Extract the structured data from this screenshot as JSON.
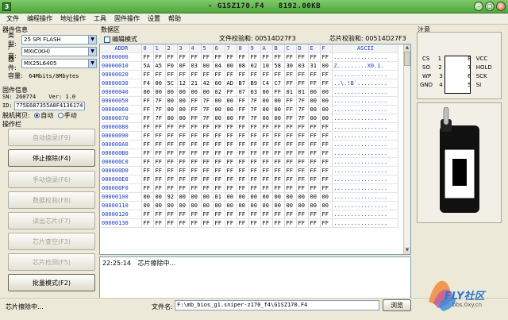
{
  "window": {
    "title": "- G1SZ170.F4   8192.00KB",
    "icon_label": "3"
  },
  "menu": [
    "文件",
    "编程操作",
    "地址操作",
    "工具",
    "固件操作",
    "设置",
    "帮助"
  ],
  "device_info": {
    "group_label": "器件信息",
    "type_label": "类型:",
    "type_value": "25 SPI FLASH",
    "vendor_label": "厂商:",
    "vendor_value": "MXIC(KH)",
    "device_label": "器件:",
    "device_value": "MX25L6405",
    "capacity_label": "容量:",
    "capacity_value": "64Mbits/8Mbytes"
  },
  "firmware_info": {
    "group_label": "固件信息",
    "sn_label": "SN:",
    "sn_value": "260774",
    "ver_label": "Ver:",
    "ver_value": "1.0",
    "id_label": "ID:",
    "id_value": "775E687355A0F4136174",
    "offline_label": "脱机拷贝:",
    "auto_label": "自动",
    "manual_label": "手动",
    "auto_selected": true
  },
  "operations": {
    "group_label": "操作栏",
    "buttons": [
      {
        "label": "自动烧录(F9)",
        "enabled": false
      },
      {
        "label": "停止擦除(F4)",
        "enabled": true
      },
      {
        "label": "手动烧录(F6)",
        "enabled": false
      },
      {
        "label": "数据校验(F8)",
        "enabled": false
      },
      {
        "label": "读出芯片(F7)",
        "enabled": false
      },
      {
        "label": "芯片查空(F3)",
        "enabled": false
      },
      {
        "label": "芯片检测(F5)",
        "enabled": false
      },
      {
        "label": "批量模式(F2)",
        "enabled": true
      }
    ]
  },
  "data_area": {
    "group_label": "数据区",
    "edit_mode_label": "编辑模式",
    "file_checksum_label": "文件校验和:",
    "file_checksum": "00514D27F3",
    "chip_checksum_label": "芯片校验和:",
    "chip_checksum": "00514D27F3",
    "header": [
      "ADDR",
      "0",
      "1",
      "2",
      "3",
      "4",
      "5",
      "6",
      "7",
      "8",
      "9",
      "A",
      "B",
      "C",
      "D",
      "E",
      "F",
      "ASCII"
    ],
    "rows": [
      [
        "00000000",
        "FF",
        "FF",
        "FF",
        "FF",
        "FF",
        "FF",
        "FF",
        "FF",
        "FF",
        "FF",
        "FF",
        "FF",
        "FF",
        "FF",
        "FF",
        "FF",
        "................"
      ],
      [
        "00000010",
        "5A",
        "A5",
        "F0",
        "0F",
        "03",
        "00",
        "04",
        "00",
        "08",
        "02",
        "10",
        "58",
        "30",
        "03",
        "31",
        "00",
        "Z.........X0.1."
      ],
      [
        "00000020",
        "FF",
        "FF",
        "FF",
        "FF",
        "FF",
        "FF",
        "FF",
        "FF",
        "FF",
        "FF",
        "FF",
        "FF",
        "FF",
        "FF",
        "FF",
        "FF",
        "................"
      ],
      [
        "00000030",
        "F4",
        "00",
        "5C",
        "12",
        "21",
        "42",
        "60",
        "AD",
        "B7",
        "B9",
        "C4",
        "C7",
        "FF",
        "FF",
        "FF",
        "FF",
        "..\\.!B`........."
      ],
      [
        "00000040",
        "00",
        "00",
        "00",
        "00",
        "00",
        "00",
        "02",
        "FF",
        "07",
        "03",
        "00",
        "FF",
        "01",
        "01",
        "00",
        "00",
        "................"
      ],
      [
        "00000050",
        "FF",
        "7F",
        "00",
        "00",
        "FF",
        "7F",
        "00",
        "00",
        "FF",
        "7F",
        "00",
        "00",
        "FF",
        "7F",
        "00",
        "00",
        "................"
      ],
      [
        "00000060",
        "FF",
        "7F",
        "00",
        "00",
        "FF",
        "7F",
        "00",
        "00",
        "FF",
        "7F",
        "00",
        "00",
        "FF",
        "7F",
        "00",
        "00",
        "................"
      ],
      [
        "00000070",
        "FF",
        "7F",
        "00",
        "00",
        "FF",
        "7F",
        "00",
        "00",
        "FF",
        "7F",
        "00",
        "00",
        "FF",
        "7F",
        "00",
        "00",
        "................"
      ],
      [
        "00000080",
        "FF",
        "FF",
        "FF",
        "FF",
        "FF",
        "FF",
        "FF",
        "FF",
        "FF",
        "FF",
        "FF",
        "FF",
        "FF",
        "FF",
        "FF",
        "FF",
        "................"
      ],
      [
        "00000090",
        "FF",
        "FF",
        "FF",
        "FF",
        "FF",
        "FF",
        "FF",
        "FF",
        "FF",
        "FF",
        "FF",
        "FF",
        "FF",
        "FF",
        "FF",
        "FF",
        "................"
      ],
      [
        "000000A0",
        "FF",
        "FF",
        "FF",
        "FF",
        "FF",
        "FF",
        "FF",
        "FF",
        "FF",
        "FF",
        "FF",
        "FF",
        "FF",
        "FF",
        "FF",
        "FF",
        "................"
      ],
      [
        "000000B0",
        "FF",
        "FF",
        "FF",
        "FF",
        "FF",
        "FF",
        "FF",
        "FF",
        "FF",
        "FF",
        "FF",
        "FF",
        "FF",
        "FF",
        "FF",
        "FF",
        "................"
      ],
      [
        "000000C0",
        "FF",
        "FF",
        "FF",
        "FF",
        "FF",
        "FF",
        "FF",
        "FF",
        "FF",
        "FF",
        "FF",
        "FF",
        "FF",
        "FF",
        "FF",
        "FF",
        "................"
      ],
      [
        "000000D0",
        "FF",
        "FF",
        "FF",
        "FF",
        "FF",
        "FF",
        "FF",
        "FF",
        "FF",
        "FF",
        "FF",
        "FF",
        "FF",
        "FF",
        "FF",
        "FF",
        "................"
      ],
      [
        "000000E0",
        "FF",
        "FF",
        "FF",
        "FF",
        "FF",
        "FF",
        "FF",
        "FF",
        "FF",
        "FF",
        "FF",
        "FF",
        "FF",
        "FF",
        "FF",
        "FF",
        "................"
      ],
      [
        "000000F0",
        "FF",
        "FF",
        "FF",
        "FF",
        "FF",
        "FF",
        "FF",
        "FF",
        "FF",
        "FF",
        "FF",
        "FF",
        "FF",
        "FF",
        "FF",
        "FF",
        "................"
      ],
      [
        "00000100",
        "00",
        "00",
        "92",
        "00",
        "00",
        "00",
        "01",
        "00",
        "00",
        "00",
        "00",
        "00",
        "00",
        "00",
        "00",
        "00",
        "................"
      ],
      [
        "00000110",
        "00",
        "00",
        "00",
        "00",
        "00",
        "00",
        "00",
        "00",
        "00",
        "00",
        "00",
        "00",
        "00",
        "00",
        "00",
        "00",
        "................"
      ],
      [
        "00000120",
        "FF",
        "FF",
        "FF",
        "FF",
        "FF",
        "FF",
        "FF",
        "FF",
        "FF",
        "FF",
        "FF",
        "FF",
        "FF",
        "FF",
        "FF",
        "FF",
        "................"
      ],
      [
        "00000130",
        "FF",
        "FF",
        "FF",
        "FF",
        "FF",
        "FF",
        "FF",
        "FF",
        "FF",
        "FF",
        "FF",
        "FF",
        "FF",
        "FF",
        "FF",
        "FF",
        "................"
      ]
    ]
  },
  "log": {
    "time": "22:25:14",
    "message": "芯片擦除中..."
  },
  "notes": {
    "group_label": "注意",
    "pins_left": [
      {
        "name": "CS",
        "num": "1"
      },
      {
        "name": "SO",
        "num": "2"
      },
      {
        "name": "WP",
        "num": "3"
      },
      {
        "name": "GND",
        "num": "4"
      }
    ],
    "pins_right": [
      {
        "num": "8",
        "name": "VCC"
      },
      {
        "num": "7",
        "name": "HOLD"
      },
      {
        "num": "6",
        "name": "SCK"
      },
      {
        "num": "5",
        "name": "SI"
      }
    ]
  },
  "status": {
    "text": "芯片擦除中...",
    "filename_label": "文件名:",
    "filename_value": "F:\\mb_bios_g1.sniper-z170_f4\\G1SZ170.F4",
    "browse_label": "浏览",
    "watermark_brand": "FLY社区",
    "watermark_url": "bbs.0xy.cn"
  },
  "colors": {
    "accent_blue": "#1a3cc0",
    "title_green": "#4ea83a"
  }
}
